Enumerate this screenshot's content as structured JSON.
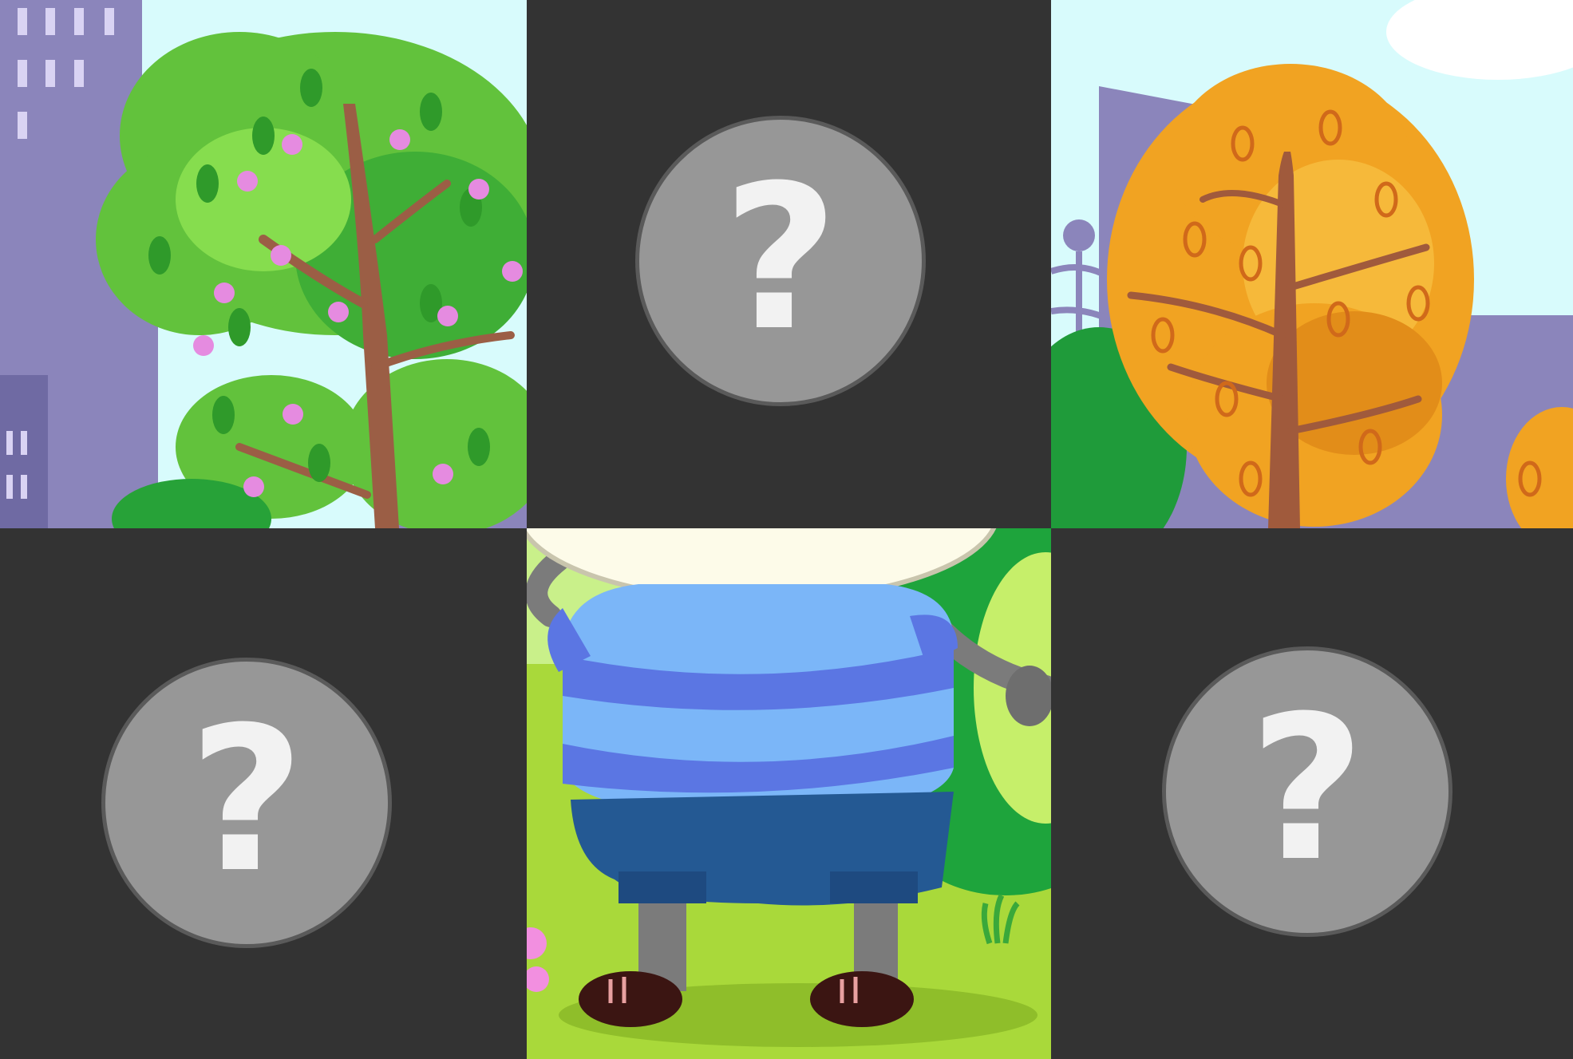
{
  "game": {
    "name": "memory-card-puzzle",
    "grid": {
      "rows": 2,
      "cols": 3
    }
  },
  "tiles": [
    {
      "id": "r1c1",
      "state": "revealed",
      "scene": "green-tree-with-pink-flowers"
    },
    {
      "id": "r1c2",
      "state": "hidden",
      "symbol": "?"
    },
    {
      "id": "r1c3",
      "state": "revealed",
      "scene": "orange-autumn-tree"
    },
    {
      "id": "r2c1",
      "state": "hidden",
      "symbol": "?"
    },
    {
      "id": "r2c2",
      "state": "revealed",
      "scene": "character-in-striped-shirt"
    },
    {
      "id": "r2c3",
      "state": "hidden",
      "symbol": "?"
    }
  ],
  "colors": {
    "hidden_tile": "#333333",
    "badge_fill": "#979797",
    "badge_border": "#5a5a5a",
    "glyph": "#f2f2f2",
    "sky": "#d8fbfc",
    "building": "#8b85bb",
    "grass": "#a9d93a"
  },
  "icons": {
    "hidden_badge": "question-mark-icon"
  }
}
